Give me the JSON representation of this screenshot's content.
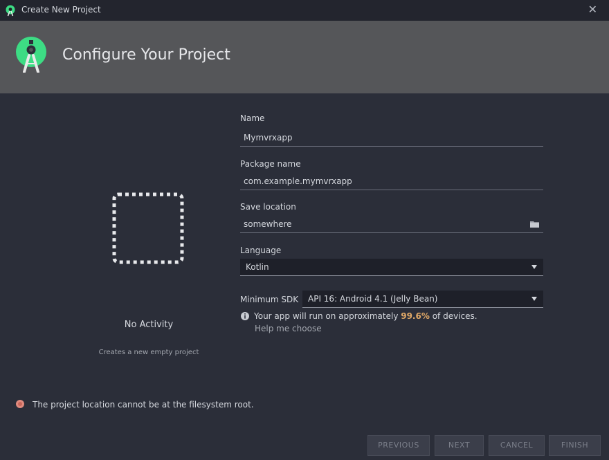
{
  "window": {
    "title": "Create New Project",
    "close_glyph": "✕"
  },
  "header": {
    "title": "Configure Your Project"
  },
  "preview": {
    "activity_name": "No Activity",
    "activity_description": "Creates a new empty project"
  },
  "form": {
    "name": {
      "label": "Name",
      "value": "Mymvrxapp"
    },
    "package_name": {
      "label": "Package name",
      "value": "com.example.mymvrxapp"
    },
    "save_location": {
      "label": "Save location",
      "value": "somewhere"
    },
    "language": {
      "label": "Language",
      "value": "Kotlin"
    },
    "minimum_sdk": {
      "label": "Minimum SDK",
      "value": "API 16: Android 4.1 (Jelly Bean)"
    },
    "info": {
      "prefix": "Your app will run on approximately ",
      "percent": "99.6%",
      "suffix": " of devices."
    },
    "help_link": "Help me choose"
  },
  "error": {
    "message": "The project location cannot be at the filesystem root."
  },
  "buttons": {
    "previous": "PREVIOUS",
    "next": "NEXT",
    "cancel": "CANCEL",
    "finish": "FINISH"
  },
  "colors": {
    "background": "#2b2e39",
    "header_band": "#555659",
    "android_green": "#3ddc84",
    "percent_accent": "#e0a867",
    "error_icon": "#e08a7e"
  }
}
